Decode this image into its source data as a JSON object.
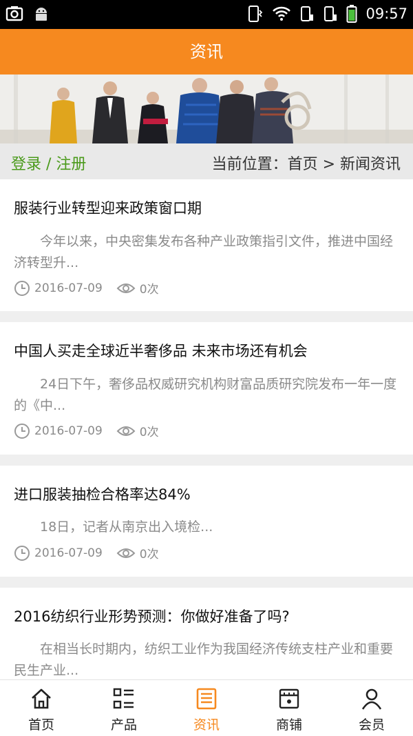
{
  "status_bar": {
    "time": "09:57"
  },
  "header": {
    "title": "资讯"
  },
  "location_bar": {
    "login_register": "登录 / 注册",
    "breadcrumb": "当前位置：首页 > 新闻资讯"
  },
  "articles": [
    {
      "title": "服装行业转型迎来政策窗口期",
      "summary": "今年以来，中央密集发布各种产业政策指引文件，推进中国经济转型升...",
      "date": "2016-07-09",
      "views": "0次"
    },
    {
      "title": "中国人买走全球近半奢侈品 未来市场还有机会",
      "summary": "24日下午，奢侈品权威研究机构财富品质研究院发布一年一度的《中...",
      "date": "2016-07-09",
      "views": "0次"
    },
    {
      "title": "进口服装抽检合格率达84%",
      "summary": "  18日，记者从南京出入境检...",
      "date": "2016-07-09",
      "views": "0次"
    },
    {
      "title": "2016纺织行业形势预测：你做好准备了吗?",
      "summary": "在相当长时期内，纺织工业作为我国经济传统支柱产业和重要民生产业...",
      "date": "",
      "views": ""
    }
  ],
  "tabs": [
    {
      "label": "首页",
      "icon": "home-icon"
    },
    {
      "label": "产品",
      "icon": "grid-list-icon"
    },
    {
      "label": "资讯",
      "icon": "document-icon",
      "active": true
    },
    {
      "label": "商铺",
      "icon": "shop-icon"
    },
    {
      "label": "会员",
      "icon": "user-icon"
    }
  ],
  "colors": {
    "accent": "#f6891f",
    "login_green": "#4a9a1b"
  }
}
